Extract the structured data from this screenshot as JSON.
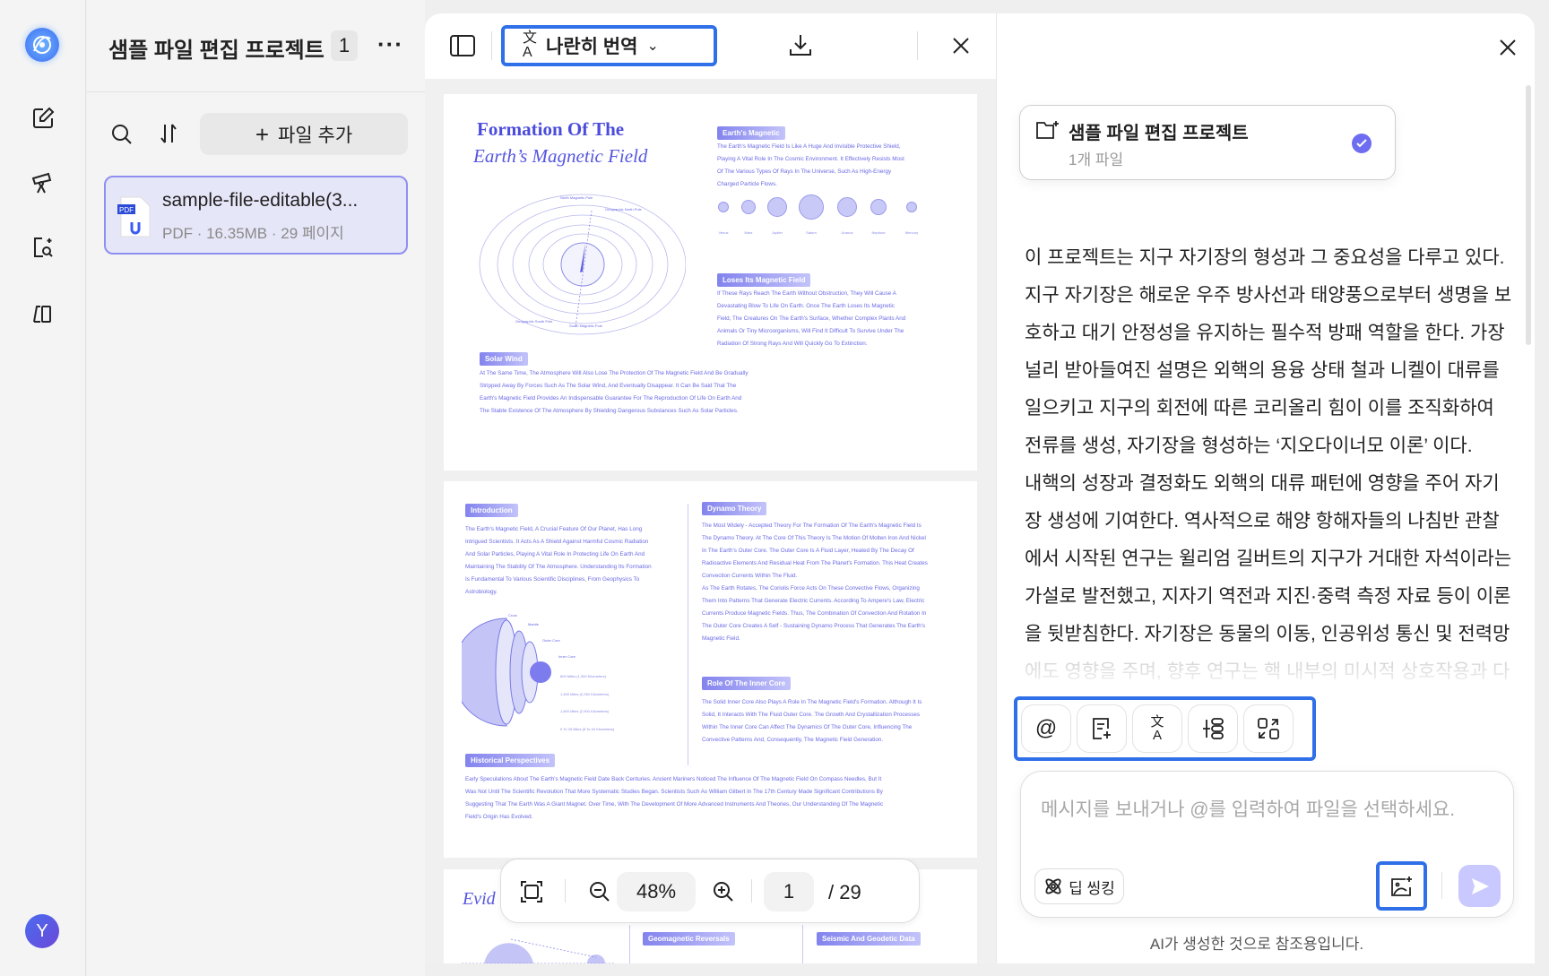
{
  "rail": {
    "avatar_letter": "Y"
  },
  "files_panel": {
    "project_title": "샘플 파일 편집 프로젝트",
    "file_count": "1",
    "more_label": "···",
    "add_file_label": "파일 추가",
    "file": {
      "name": "sample-file-editable(3...",
      "meta": "PDF · 16.35MB · 29 페이지",
      "badge": "PDF"
    }
  },
  "doc_viewer": {
    "translate_mode": "나란히 번역",
    "zoom": "48%",
    "page_current": "1",
    "page_total": "/ 29",
    "page1": {
      "title1": "Formation Of The",
      "title2": "Earth’s Magnetic Field",
      "tag_magnetic": "Earth's Magnetic",
      "para_magnetic": [
        "The Earth's Magnetic Field Is Like A Huge And Invisible Protective Shield,",
        "Playing A Vital Role In The Cosmic Environment. It Effectively Resists Most",
        "Of The Various Types Of Rays In The Universe, Such As High-Energy",
        "Charged Particle Flows."
      ],
      "planets": [
        "Venus",
        "Mars",
        "Jupiter",
        "Saturn",
        "Uranus",
        "Neptune",
        "Mercury"
      ],
      "diagram_labels": [
        "North Magnetic Pole",
        "Geographic North Pole",
        "Geographic South Pole",
        "South Magnetic Pole"
      ],
      "tag_loses": "Loses Its Magnetic Field",
      "para_loses": [
        "If These Rays Reach The Earth Without Obstruction, They Will Cause A",
        "Devastating Blow To Life On Earth. Once The Earth Loses Its Magnetic",
        "Field, The Creatures On The Earth's Surface, Whether Complex Plants And",
        "Animals Or Tiny Microorganisms, Will Find It Difficult To Survive Under The",
        "Radiation Of Strong Rays And Will Quickly Go To Extinction."
      ],
      "tag_solar": "Solar Wind",
      "para_solar": [
        "At The Same Time, The Atmosphere Will Also Lose The Protection Of The Magnetic Field And Be Gradually",
        "Stripped Away By Forces Such As The Solar Wind, And Eventually Disappear. It Can Be Said That The",
        "Earth's Magnetic Field Provides An Indispensable Guarantee For The Reproduction Of Life On Earth And",
        "The Stable Existence Of The Atmosphere By Shielding Dangerous Substances Such As Solar Particles."
      ]
    },
    "page2": {
      "tag_intro": "Introduction",
      "para_intro": [
        "The Earth's Magnetic Field, A Crucial Feature Of Our Planet, Has Long",
        "Intrigued Scientists. It Acts As A Shield Against Harmful Cosmic Radiation",
        "And Solar Particles, Playing A Vital Role In Protecting Life On Earth And",
        "Maintaining The Stability Of The Atmosphere. Understanding Its Formation",
        "Is Fundamental To Various Scientific Disciplines, From Geophysics To",
        "Astrobiology."
      ],
      "layer_labels": [
        "Crust",
        "Mantle",
        "Outer Core",
        "Inner Core"
      ],
      "depth_labels": [
        "800 Miles (1,300 Kilometers)",
        "1,400 Miles (2,250 Kilometers)",
        "1,800 Miles (2,900 Kilometers)",
        "5 To 25 Miles (8 To 40 Kilometers)"
      ],
      "tag_dynamo": "Dynamo Theory",
      "para_dynamo": [
        "The Most Widely - Accepted Theory For The Formation Of The Earth's Magnetic Field Is",
        "The Dynamo Theory. At The Core Of This Theory Is The Motion Of Molten Iron And Nickel",
        "In The Earth's Outer Core. The Outer Core Is A Fluid Layer, Heated By The Decay Of",
        "Radioactive Elements And Residual Heat From The Planet's Formation. This Heat Creates",
        "Convection Currents Within The Fluid.",
        "As The Earth Rotates, The Coriolis Force Acts On These Convective Flows, Organizing",
        "Them Into Patterns That Generate Electric Currents. According To Ampere's Law, Electric",
        "Currents Produce Magnetic Fields. Thus, The Combination Of Convection And Rotation In",
        "The Outer Core Creates A Self - Sustaining Dynamo Process That Generates The Earth's",
        "Magnetic Field."
      ],
      "tag_inner": "Role Of The Inner Core",
      "para_inner": [
        "The Solid Inner Core Also Plays A Role In The Magnetic Field's Formation. Although It Is",
        "Solid, It Interacts With The Fluid Outer Core. The Growth And Crystallization Processes",
        "Within The Inner Core Can Affect The Dynamics Of The Outer Core, Influencing The",
        "Convective Patterns And, Consequently, The Magnetic Field Generation."
      ],
      "tag_hist": "Historical Perspectives",
      "para_hist": [
        "Early Speculations About The Earth's Magnetic Field Date Back Centuries. Ancient Mariners Noticed The Influence Of The Magnetic Field On Compass Needles, But It",
        "Was Not Until The Scientific Revolution That More Systematic Studies Began. Scientists Such As William Gilbert In The 17th Century Made Significant Contributions By",
        "Suggesting That The Earth Was A Giant Magnet. Over Time, With The Development Of More Advanced Instruments And Theories, Our Understanding Of The Magnetic",
        "Field's Origin Has Evolved."
      ]
    },
    "page3": {
      "title_partial": "Evid",
      "tag_reversals": "Geomagnetic Reversals",
      "tag_seismic": "Seismic And Geodetic Data"
    }
  },
  "chat": {
    "project_card": {
      "title": "샘플 파일 편집 프로젝트",
      "subtitle": "1개 파일"
    },
    "body_lines": [
      "이 프로젝트는 지구 자기장의 형성과 그 중요성을 다루고 있다.",
      "지구 자기장은 해로운 우주 방사선과 태양풍으로부터 생명을 보",
      "호하고 대기 안정성을 유지하는 필수적 방패 역할을 한다. 가장",
      "널리 받아들여진 설명은 외핵의 용융 상태 철과 니켈이 대류를",
      "일으키고 지구의 회전에 따른 코리올리 힘이 이를 조직화하여",
      "전류를 생성, 자기장을 형성하는  ‘지오다이너모 이론’ 이다.",
      "내핵의 성장과 결정화도 외핵의 대류 패턴에 영향을 주어 자기",
      "장 생성에 기여한다. 역사적으로 해양 항해자들의 나침반 관찰",
      "에서 시작된 연구는 윌리엄 길버트의 지구가 거대한 자석이라는",
      "가설로 발전했고, 지자기 역전과 지진·중력 측정 자료 등이 이론",
      "을 뒷받침한다. 자기장은 동물의 이동, 인공위성 통신 및 전력망",
      "에도 영향을 주며, 향후 연구는 핵 내부의 미시적 상호작용과 다"
    ],
    "input_placeholder": "메시지를 보내거나 @를 입력하여 파일을 선택하세요.",
    "deep_thinking_label": "딥 씽킹",
    "footer_note": "AI가 생성한 것으로 참조용입니다."
  },
  "colors": {
    "accent_blue": "#2f6fe8",
    "doc_purple": "#6a6ae6",
    "check_purple": "#6e6cf0",
    "send_disabled": "#c9c9ff"
  }
}
